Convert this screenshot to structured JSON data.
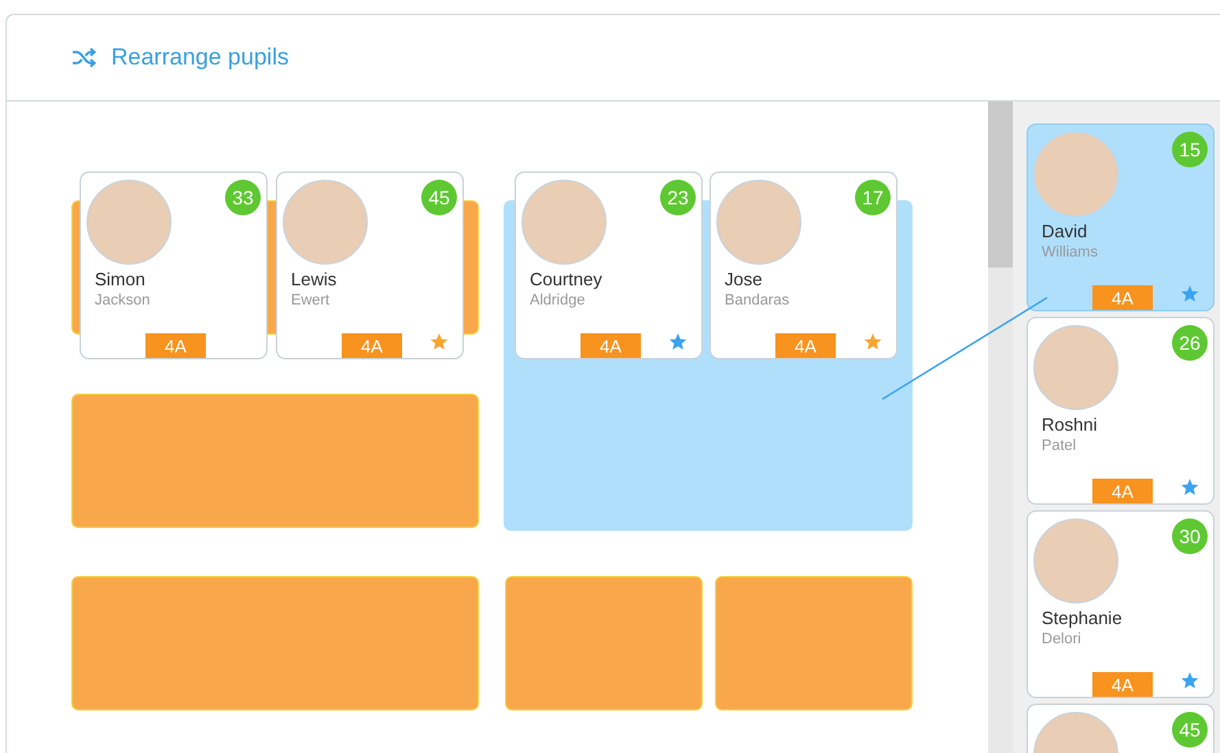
{
  "header": {
    "title": "Rearrange pupils"
  },
  "tables": [
    {
      "highlighted": false,
      "pupils": [
        {
          "first_name": "Simon",
          "last_name": "Jackson",
          "score": "33",
          "class": "4A"
        },
        {
          "first_name": "Lewis",
          "last_name": "Ewert",
          "score": "45",
          "class": "4A",
          "star": {
            "color": "#f7a531"
          }
        }
      ]
    },
    {
      "highlighted": false
    },
    {
      "highlighted": true,
      "pupils": [
        {
          "first_name": "Courtney",
          "last_name": "Aldridge",
          "score": "23",
          "class": "4A",
          "star": {
            "color": "#3ba3f0"
          }
        },
        {
          "first_name": "Jose",
          "last_name": "Bandaras",
          "score": "17",
          "class": "4A",
          "star": {
            "color": "#f7a531"
          }
        }
      ]
    },
    {
      "highlighted": false
    },
    {
      "highlighted": false
    },
    {
      "highlighted": false
    }
  ],
  "sidebar": {
    "pupils": [
      {
        "selected": true,
        "first_name": "David",
        "last_name": "Williams",
        "score": "15",
        "class": "4A",
        "star": {
          "color": "#3ba3f0"
        }
      },
      {
        "selected": false,
        "first_name": "Roshni",
        "last_name": "Patel",
        "score": "26",
        "class": "4A",
        "star": {
          "color": "#3ba3f0"
        }
      },
      {
        "selected": false,
        "first_name": "Stephanie",
        "last_name": "Delori",
        "score": "30",
        "class": "4A",
        "star": {
          "color": "#3ba3f0"
        }
      },
      {
        "selected": false,
        "score": "45"
      }
    ]
  }
}
